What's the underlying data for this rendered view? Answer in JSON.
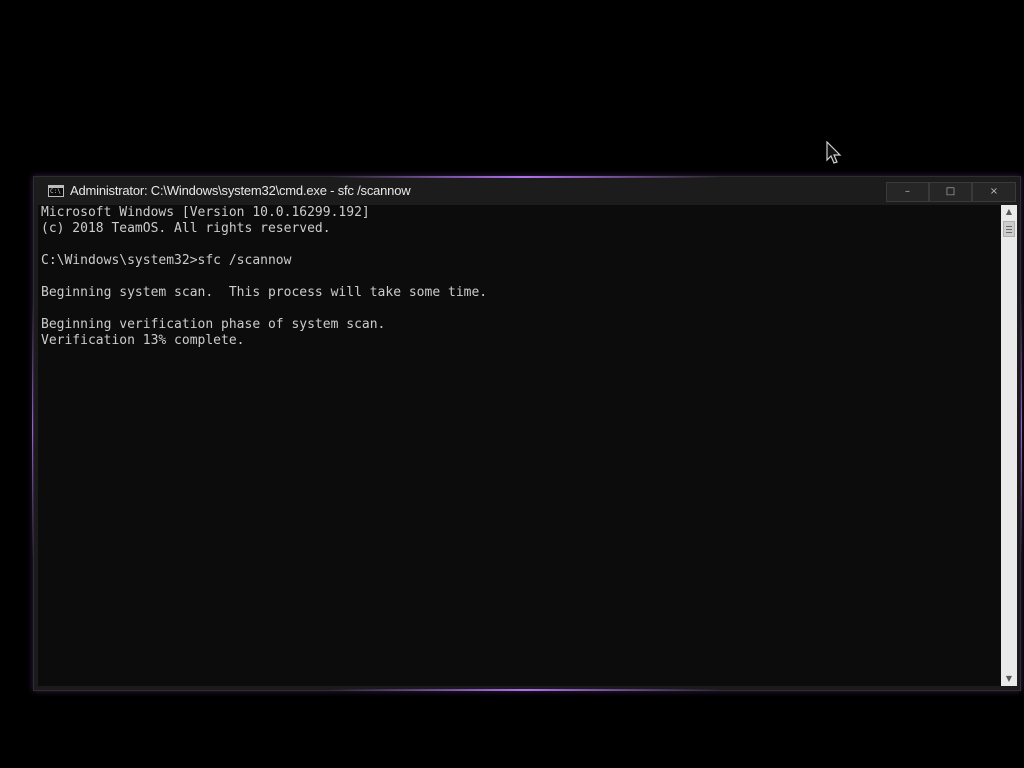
{
  "window": {
    "title": "Administrator: C:\\Windows\\system32\\cmd.exe - sfc  /scannow",
    "icon": "cmd-icon",
    "icon_text": "C:\\",
    "controls": {
      "minimize": "–",
      "maximize": "□",
      "close": "×"
    }
  },
  "console": {
    "lines": [
      "Microsoft Windows [Version 10.0.16299.192]",
      "(c) 2018 TeamOS. All rights reserved.",
      "",
      "C:\\Windows\\system32>sfc /scannow",
      "",
      "Beginning system scan.  This process will take some time.",
      "",
      "Beginning verification phase of system scan.",
      "Verification 13% complete."
    ]
  },
  "scrollbar": {
    "up": "▲",
    "down": "▼"
  },
  "colors": {
    "desktop": "#000000",
    "console_bg": "#0c0c0c",
    "console_text": "#cccccc",
    "accent_glow": "#b070ee"
  }
}
